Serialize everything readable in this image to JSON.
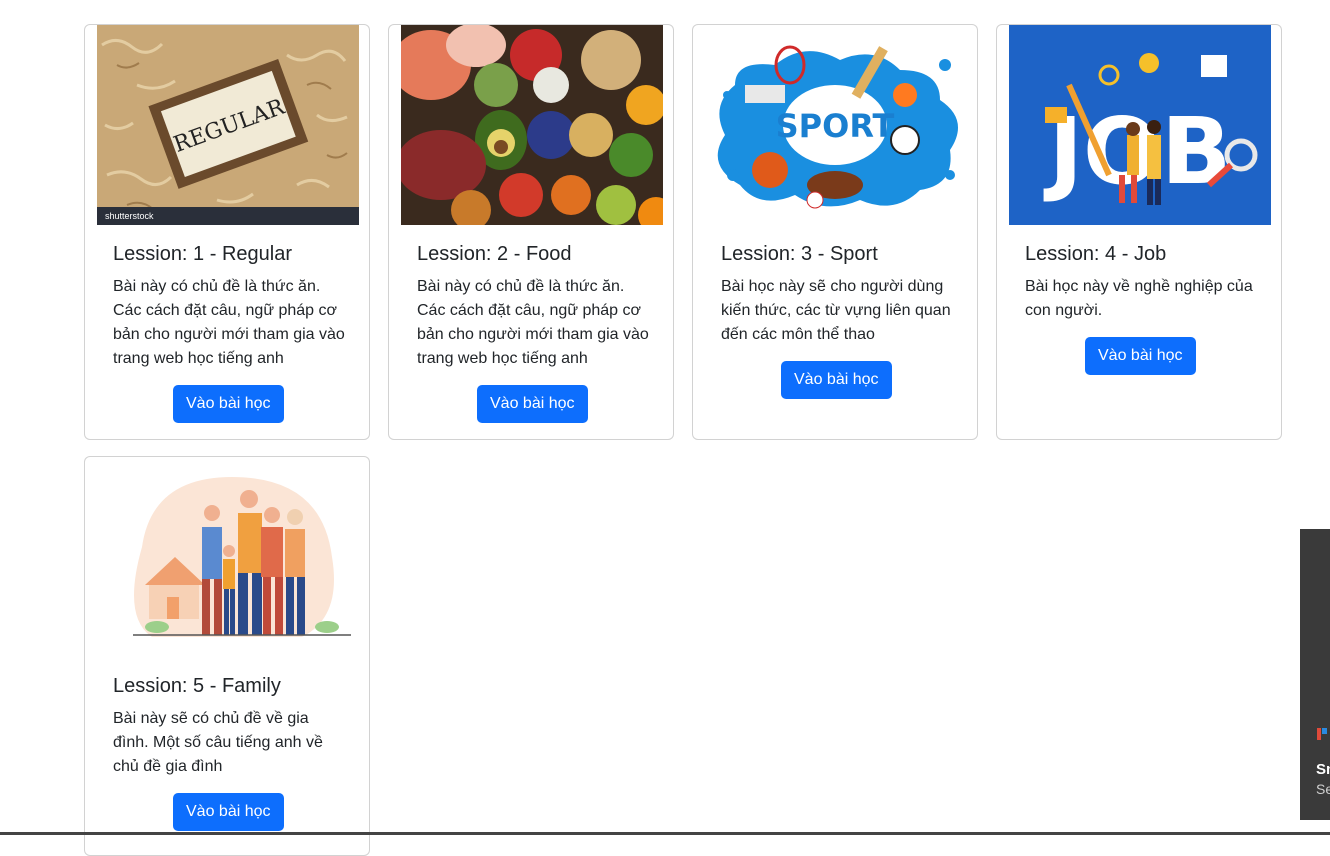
{
  "lessons": [
    {
      "title": "Lession: 1 - Regular",
      "description": "Bài này có chủ đề là thức ăn. Các cách đặt câu, ngữ pháp cơ bản cho người mới tham gia vào trang web học tiếng anh",
      "button": "Vào bài học",
      "image_text": "REGULAR",
      "watermark": "shutterstock"
    },
    {
      "title": "Lession: 2 - Food",
      "description": "Bài này có chủ đề là thức ăn. Các cách đặt câu, ngữ pháp cơ bản cho người mới tham gia vào trang web học tiếng anh",
      "button": "Vào bài học"
    },
    {
      "title": "Lession: 3 - Sport",
      "description": "Bài học này sẽ cho người dùng kiến thức, các từ vựng liên quan đến các môn thể thao",
      "button": "Vào bài học",
      "image_text": "SPORT"
    },
    {
      "title": "Lession: 4 - Job",
      "description": "Bài học này về nghề nghiệp của con người.",
      "button": "Vào bài học",
      "image_text": "JOB"
    },
    {
      "title": "Lession: 5 - Family",
      "description": "Bài này sẽ có chủ đề về gia đình. Một số câu tiếng anh về chủ đề gia đình",
      "button": "Vào bài học"
    }
  ],
  "side_panel": {
    "title": "Sn",
    "subtitle": "Se"
  },
  "colors": {
    "primary": "#0d6efd",
    "panel": "#3a3a3a",
    "job_bg": "#1e63c6",
    "sport_blue": "#1a8fe0"
  }
}
